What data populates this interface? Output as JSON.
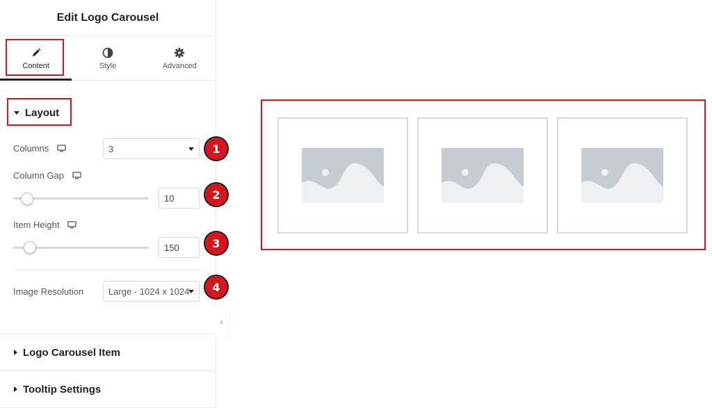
{
  "panel": {
    "title": "Edit Logo Carousel",
    "tabs": [
      {
        "label": "Content",
        "icon": "pencil-icon",
        "active": true
      },
      {
        "label": "Style",
        "icon": "half-circle-icon",
        "active": false
      },
      {
        "label": "Advanced",
        "icon": "gear-icon",
        "active": false
      }
    ]
  },
  "layout_section": {
    "title": "Layout",
    "columns": {
      "label": "Columns",
      "value": "3",
      "badge": "1"
    },
    "column_gap": {
      "label": "Column Gap",
      "value": "10",
      "badge": "2",
      "level": 0.1
    },
    "item_height": {
      "label": "Item Height",
      "value": "150",
      "badge": "3",
      "level": 0.15
    },
    "image_resolution": {
      "label": "Image Resolution",
      "value": "Large - 1024 x 1024",
      "badge": "4"
    }
  },
  "sections": [
    {
      "title": "Logo Carousel Item"
    },
    {
      "title": "Tooltip Settings"
    }
  ],
  "preview": {
    "logos": [
      "placeholder-image-icon",
      "placeholder-image-icon",
      "placeholder-image-icon"
    ]
  },
  "colors": {
    "highlight": "#d5161f",
    "placeholder": "#c6ccd2"
  }
}
